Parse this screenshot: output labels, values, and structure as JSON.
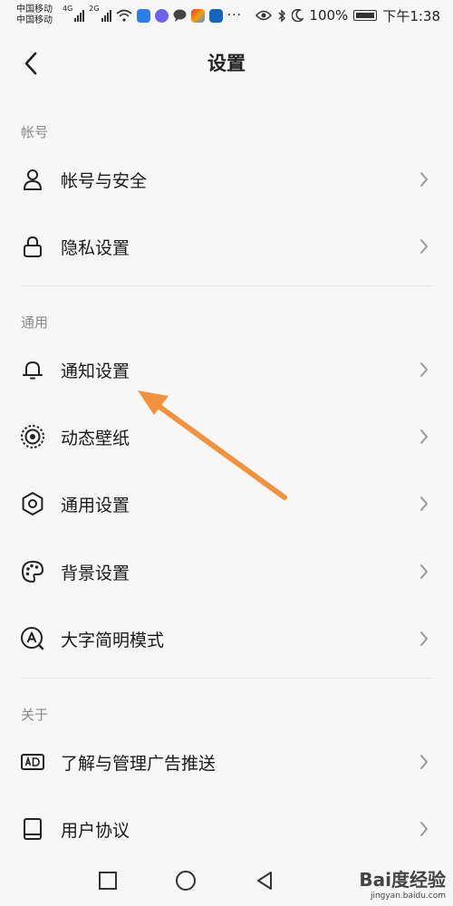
{
  "status_bar": {
    "carrier_1": "中国移动",
    "carrier_2": "中国移动",
    "net_1": "4G",
    "net_2": "2G",
    "battery": "100%",
    "time": "下午1:38"
  },
  "header": {
    "title": "设置"
  },
  "sections": [
    {
      "label": "帐号",
      "items": [
        {
          "label": "帐号与安全",
          "icon": "user-icon"
        },
        {
          "label": "隐私设置",
          "icon": "lock-icon"
        }
      ]
    },
    {
      "label": "通用",
      "items": [
        {
          "label": "通知设置",
          "icon": "bell-icon"
        },
        {
          "label": "动态壁纸",
          "icon": "live-wallpaper-icon"
        },
        {
          "label": "通用设置",
          "icon": "gear-icon"
        },
        {
          "label": "背景设置",
          "icon": "palette-icon"
        },
        {
          "label": "大字简明模式",
          "icon": "large-font-icon"
        }
      ]
    },
    {
      "label": "关于",
      "items": [
        {
          "label": "了解与管理广告推送",
          "icon": "ad-icon"
        },
        {
          "label": "用户协议",
          "icon": "book-icon"
        }
      ]
    }
  ],
  "watermark": {
    "brand": "Bai度经验",
    "site": "jingyan.baidu.com"
  },
  "colors": {
    "annotation_arrow": "#f0923e",
    "text": "#1a1a1a",
    "section_label": "#8a8a8a"
  }
}
